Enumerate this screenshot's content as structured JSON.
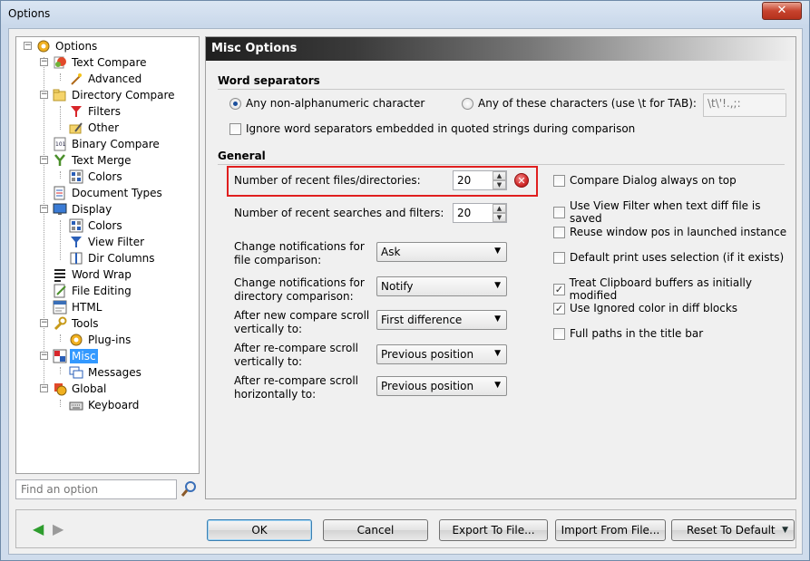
{
  "window": {
    "title": "Options",
    "close_label": "✕"
  },
  "tree": {
    "items": [
      {
        "label": "Options"
      },
      {
        "label": "Text Compare"
      },
      {
        "label": "Advanced"
      },
      {
        "label": "Directory Compare"
      },
      {
        "label": "Filters"
      },
      {
        "label": "Other"
      },
      {
        "label": "Binary Compare"
      },
      {
        "label": "Text Merge"
      },
      {
        "label": "Colors"
      },
      {
        "label": "Document Types"
      },
      {
        "label": "Display"
      },
      {
        "label": "Colors"
      },
      {
        "label": "View Filter"
      },
      {
        "label": "Dir Columns"
      },
      {
        "label": "Word Wrap"
      },
      {
        "label": "File Editing"
      },
      {
        "label": "HTML"
      },
      {
        "label": "Tools"
      },
      {
        "label": "Plug-ins"
      },
      {
        "label": "Misc"
      },
      {
        "label": "Messages"
      },
      {
        "label": "Global"
      },
      {
        "label": "Keyboard"
      }
    ],
    "selected": "Misc"
  },
  "search": {
    "placeholder": "Find an option"
  },
  "panel": {
    "title": "Misc Options",
    "word_separators": {
      "section": "Word separators",
      "radio_any": "Any non-alphanumeric character",
      "radio_these": "Any of these characters (use \\t for TAB):",
      "chars_value": "\\t\\'!.,;:",
      "ignore_quoted": "Ignore word separators embedded in quoted strings during comparison"
    },
    "general": {
      "section": "General",
      "recent_files_label": "Number of recent files/directories:",
      "recent_files_value": "20",
      "recent_searches_label": "Number of recent searches and filters:",
      "recent_searches_value": "20",
      "notif_file_label": "Change notifications for file comparison:",
      "notif_file_value": "Ask",
      "notif_dir_label": "Change notifications for directory comparison:",
      "notif_dir_value": "Notify",
      "after_new_label": "After new compare scroll vertically to:",
      "after_new_value": "First difference",
      "after_re_v_label": "After re-compare scroll vertically to:",
      "after_re_v_value": "Previous position",
      "after_re_h_label": "After re-compare scroll horizontally to:",
      "after_re_h_value": "Previous position"
    },
    "checkboxes": [
      {
        "label": "Compare Dialog always on top",
        "checked": false
      },
      {
        "label": "Use View Filter when text diff file is saved",
        "checked": false
      },
      {
        "label": "Reuse window pos in launched instance",
        "checked": false
      },
      {
        "label": "Default print uses selection (if it exists)",
        "checked": false
      },
      {
        "label": "Treat Clipboard buffers as initially modified",
        "checked": true
      },
      {
        "label": "Use Ignored color in diff blocks",
        "checked": true
      },
      {
        "label": "Full paths in the title bar",
        "checked": false
      }
    ]
  },
  "buttons": {
    "ok": "OK",
    "cancel": "Cancel",
    "export": "Export To File...",
    "import": "Import From File...",
    "reset": "Reset To Default"
  },
  "colors": {
    "highlight": "#e01f1f",
    "selection": "#3399ff",
    "back_arrow": "#2e9d2e",
    "forward_arrow": "#9a9a9a"
  }
}
